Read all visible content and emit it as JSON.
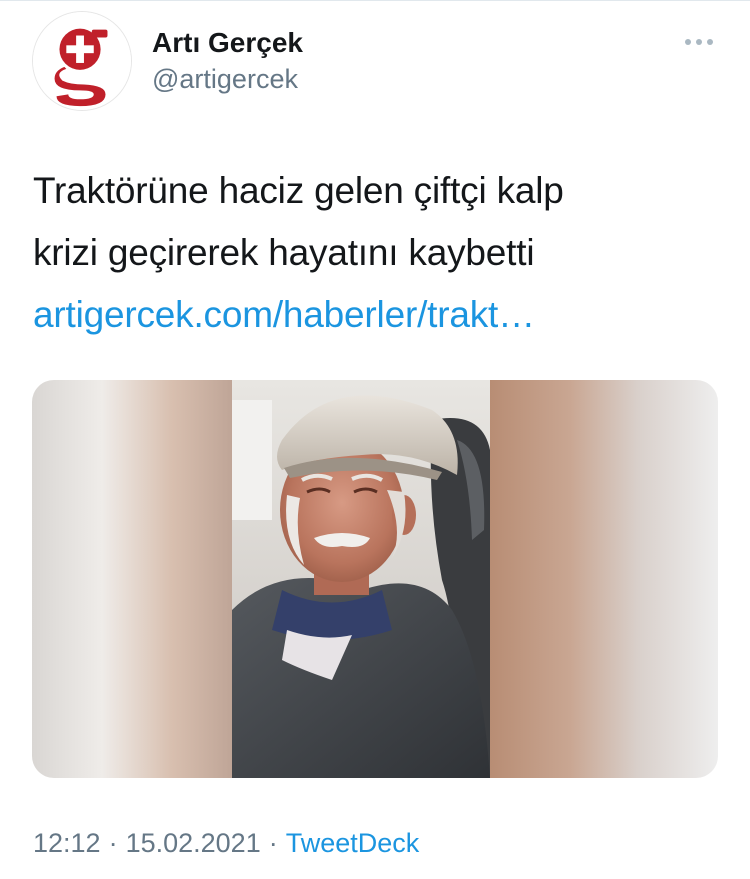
{
  "tweet": {
    "author": {
      "display_name": "Artı Gerçek",
      "handle": "@artigercek",
      "avatar_icon": "artigercek-g-logo"
    },
    "more_icon": "more-horizontal-icon",
    "text_lines": [
      "Traktörüne haciz gelen çiftçi kalp",
      "krizi geçirerek hayatını kaybetti"
    ],
    "link_text": "artigercek.com/haberler/trakt…",
    "media": {
      "type": "photo"
    },
    "time": "12:12",
    "date": "15.02.2021",
    "separator": "·",
    "source": "TweetDeck"
  },
  "colors": {
    "link": "#1b95e0",
    "secondary_text": "#657786",
    "primary_text": "#14171a",
    "logo_red": "#c0202a"
  }
}
